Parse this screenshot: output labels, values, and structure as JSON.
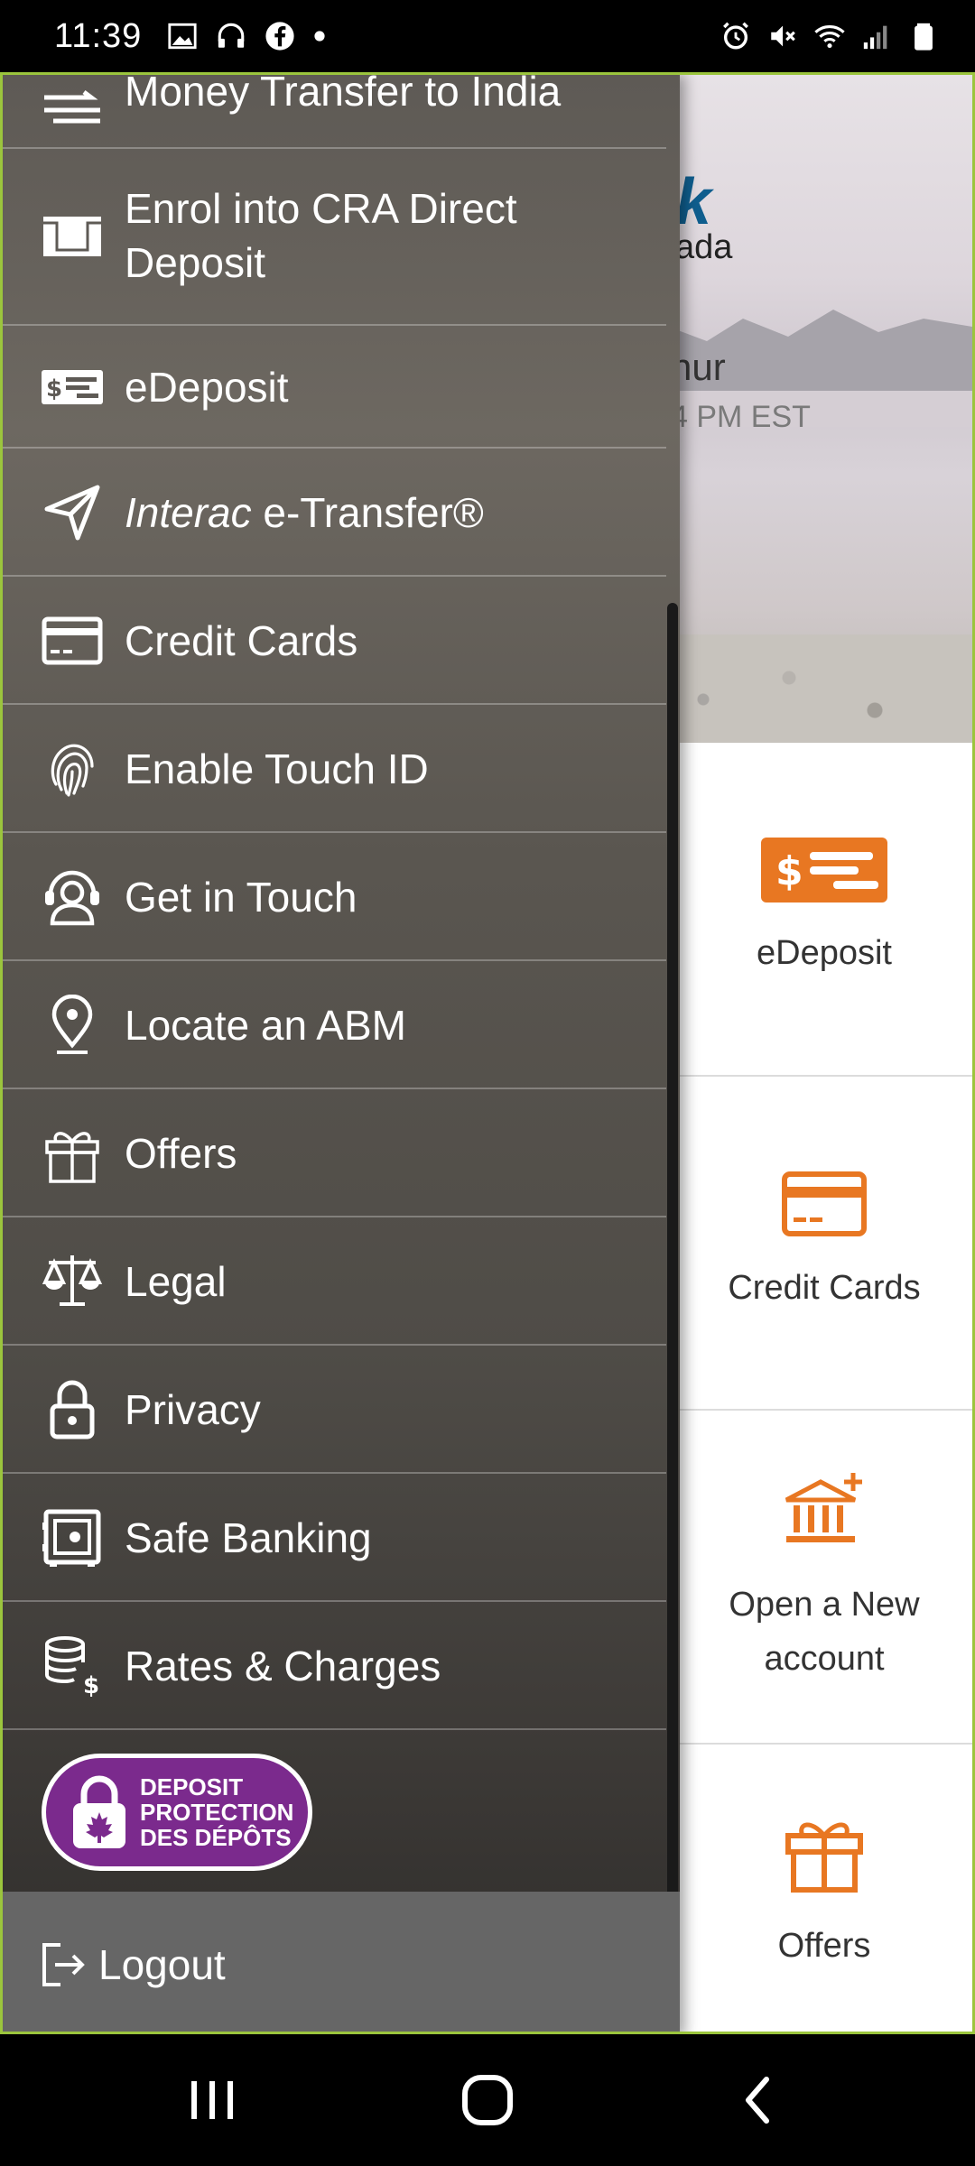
{
  "status_bar": {
    "time": "11:39"
  },
  "background": {
    "brand_partial_k": "k",
    "brand_partial_line2": "ada",
    "greeting_partial": "nur",
    "last_login_partial": "4 PM EST",
    "tiles": [
      {
        "label": "eDeposit",
        "icon": "edeposit-icon"
      },
      {
        "label": "Credit Cards",
        "icon": "credit-card-icon"
      },
      {
        "label": "Open a New account",
        "icon": "bank-plus-icon"
      },
      {
        "label": "Offers",
        "icon": "gift-icon"
      }
    ]
  },
  "drawer": {
    "items": [
      {
        "label": "Money Transfer to India",
        "icon": "transfer-arrows-icon"
      },
      {
        "label": "Enrol into CRA Direct Deposit",
        "icon": "envelope-icon"
      },
      {
        "label": "eDeposit",
        "icon": "cheque-icon"
      },
      {
        "label_italic": "Interac",
        "label_rest": " e-Transfer®",
        "icon": "send-icon"
      },
      {
        "label": "Credit Cards",
        "icon": "credit-card-icon"
      },
      {
        "label": "Enable Touch ID",
        "icon": "fingerprint-icon"
      },
      {
        "label": "Get in Touch",
        "icon": "headset-icon"
      },
      {
        "label": "Locate an ABM",
        "icon": "location-pin-icon"
      },
      {
        "label": "Offers",
        "icon": "gift-icon"
      },
      {
        "label": "Legal",
        "icon": "scales-icon"
      },
      {
        "label": "Privacy",
        "icon": "lock-icon"
      },
      {
        "label": "Safe Banking",
        "icon": "safe-icon"
      },
      {
        "label": "Rates & Charges",
        "icon": "coins-icon"
      }
    ],
    "badge": {
      "line1": "DEPOSIT",
      "line2": "PROTECTION",
      "line3": "DES DÉPÔTS"
    },
    "logout_label": "Logout"
  },
  "colors": {
    "accent_orange": "#e87722",
    "frame_green": "#9bc53d",
    "badge_purple": "#7b2a8d"
  }
}
